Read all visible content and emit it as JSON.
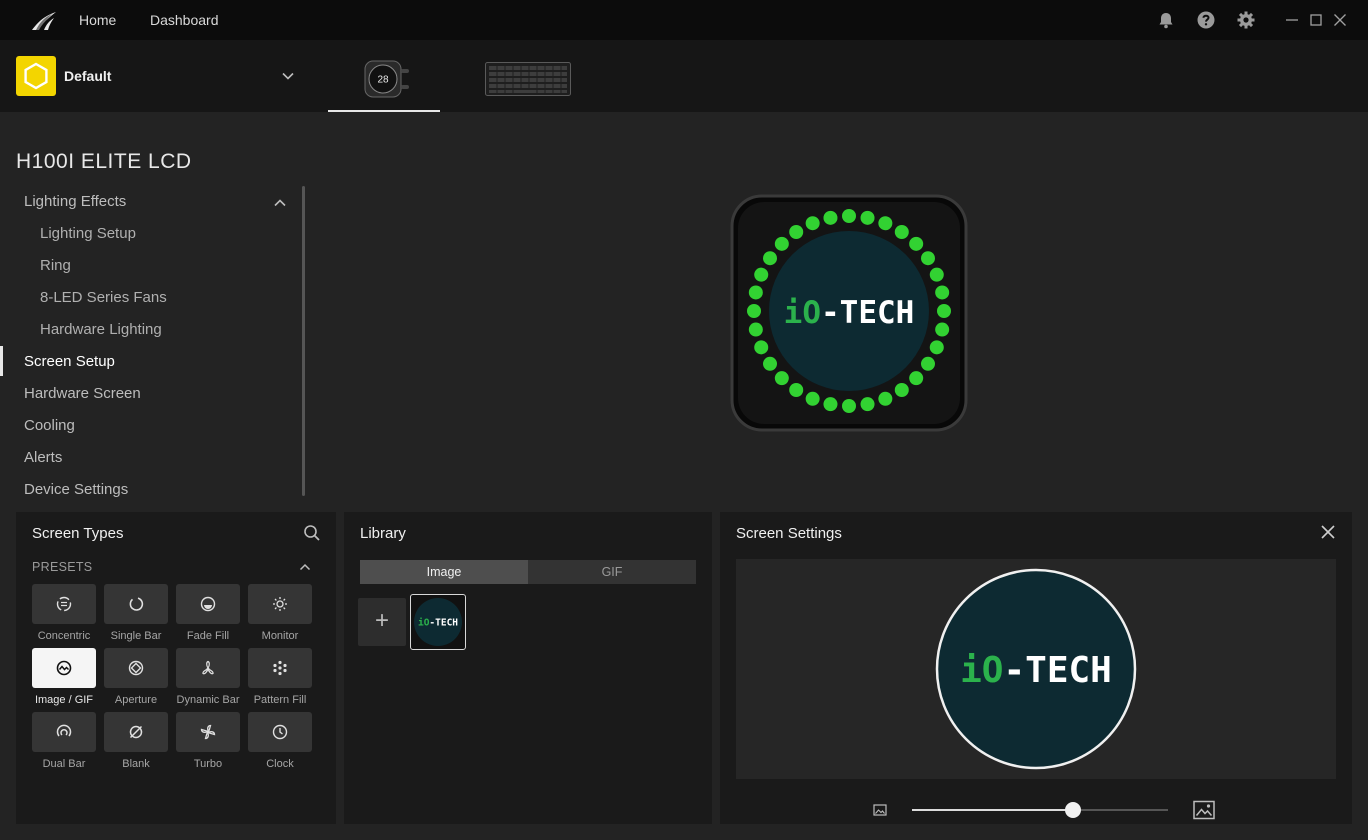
{
  "titlebar": {
    "nav": [
      "Home",
      "Dashboard"
    ],
    "icons": [
      "bell-icon",
      "help-icon",
      "gear-icon"
    ],
    "window_controls": [
      "minimize-icon",
      "maximize-icon",
      "close-icon"
    ]
  },
  "profile": {
    "name": "Default",
    "badge_color": "#f3d500"
  },
  "device_tabs": [
    {
      "name": "H100i Elite LCD cooler",
      "active": true,
      "display_text": "28"
    },
    {
      "name": "keyboard",
      "active": false
    }
  ],
  "device": {
    "title": "H100I ELITE LCD"
  },
  "sidebar": {
    "items": [
      {
        "label": "Lighting Effects",
        "level": 0,
        "expanded": true
      },
      {
        "label": "Lighting Setup",
        "level": 1
      },
      {
        "label": "Ring",
        "level": 1
      },
      {
        "label": "8-LED Series Fans",
        "level": 1
      },
      {
        "label": "Hardware Lighting",
        "level": 1
      },
      {
        "label": "Screen Setup",
        "level": 0,
        "active": true
      },
      {
        "label": "Hardware Screen",
        "level": 0
      },
      {
        "label": "Cooling",
        "level": 0
      },
      {
        "label": "Alerts",
        "level": 0
      },
      {
        "label": "Device Settings",
        "level": 0
      }
    ]
  },
  "preview": {
    "logo_text_green": "iO",
    "logo_text_white": "-TECH",
    "led_color": "#32d232",
    "led_count": 32
  },
  "screen_types": {
    "title": "Screen Types",
    "section_label": "PRESETS",
    "presets": [
      {
        "label": "Concentric",
        "icon": "concentric-icon"
      },
      {
        "label": "Single Bar",
        "icon": "single-bar-icon"
      },
      {
        "label": "Fade Fill",
        "icon": "fade-fill-icon"
      },
      {
        "label": "Monitor",
        "icon": "monitor-icon"
      },
      {
        "label": "Image / GIF",
        "icon": "image-gif-icon",
        "selected": true
      },
      {
        "label": "Aperture",
        "icon": "aperture-icon"
      },
      {
        "label": "Dynamic Bar",
        "icon": "dynamic-bar-icon"
      },
      {
        "label": "Pattern Fill",
        "icon": "pattern-fill-icon"
      },
      {
        "label": "Dual Bar",
        "icon": "dual-bar-icon"
      },
      {
        "label": "Blank",
        "icon": "blank-icon"
      },
      {
        "label": "Turbo",
        "icon": "turbo-icon"
      },
      {
        "label": "Clock",
        "icon": "clock-icon"
      }
    ]
  },
  "library": {
    "title": "Library",
    "tabs": [
      {
        "label": "Image",
        "active": true
      },
      {
        "label": "GIF",
        "active": false
      }
    ],
    "add_label": "+"
  },
  "screen_settings": {
    "title": "Screen Settings",
    "zoom_fraction": 0.63
  }
}
